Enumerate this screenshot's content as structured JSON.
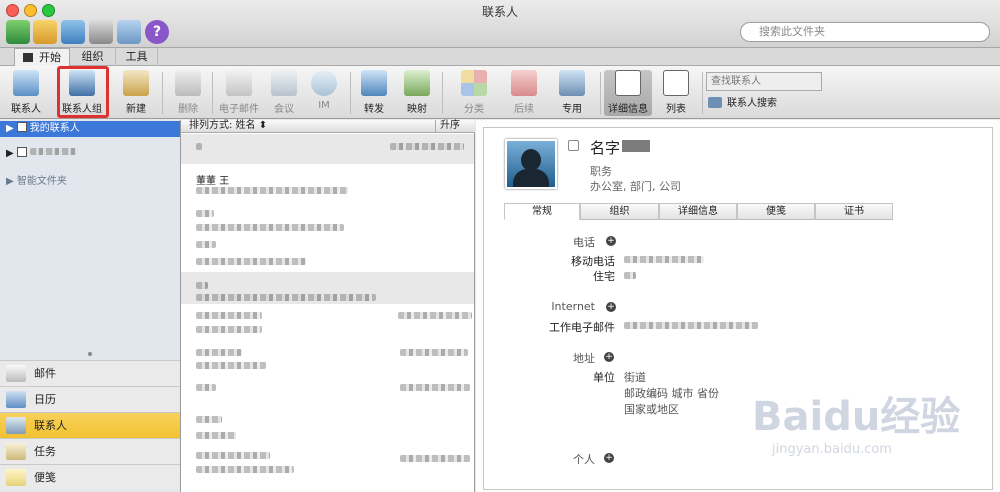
{
  "window": {
    "title": "联系人",
    "search_placeholder": "搜索此文件夹"
  },
  "ribbon_tabs": [
    "开始",
    "组织",
    "工具"
  ],
  "ribbon": {
    "buttons": {
      "contact": "联系人",
      "contact_group": "联系人组",
      "new": "新建",
      "delete": "删除",
      "email": "电子邮件",
      "meeting": "会议",
      "im": "IM",
      "forward": "转发",
      "map": "映射",
      "category": "分类",
      "followup": "后续",
      "private": "专用",
      "detail_view": "详细信息",
      "list_view": "列表"
    },
    "find_contact_placeholder": "查找联系人",
    "contact_search": "联系人搜索"
  },
  "sidebar": {
    "my_contacts": "我的联系人",
    "smart_folders": "智能文件夹"
  },
  "nav": {
    "mail": "邮件",
    "calendar": "日历",
    "contacts": "联系人",
    "tasks": "任务",
    "notes": "便笺"
  },
  "list": {
    "sort_label": "排列方式: 姓名 ⬍",
    "order": "升序",
    "entry_name": "董董 王"
  },
  "detail": {
    "name_label": "名字",
    "job_title": "职务",
    "company_line": "办公室, 部门, 公司",
    "tabs": [
      "常规",
      "组织",
      "详细信息",
      "便笺",
      "证书"
    ],
    "phone": "电话",
    "mobile": "移动电话",
    "home": "住宅",
    "internet": "Internet",
    "work_email": "工作电子邮件",
    "address": "地址",
    "work": "单位",
    "street": "街道",
    "postal_city": "邮政编码 城市 省份",
    "country": "国家或地区",
    "personal": "个人"
  },
  "watermark": {
    "brand": "Baidu经验",
    "url": "jingyan.baidu.com"
  },
  "colors": {
    "selection": "#3c78d8",
    "highlight": "#e0302f",
    "nav_selected": "#f2c232"
  }
}
